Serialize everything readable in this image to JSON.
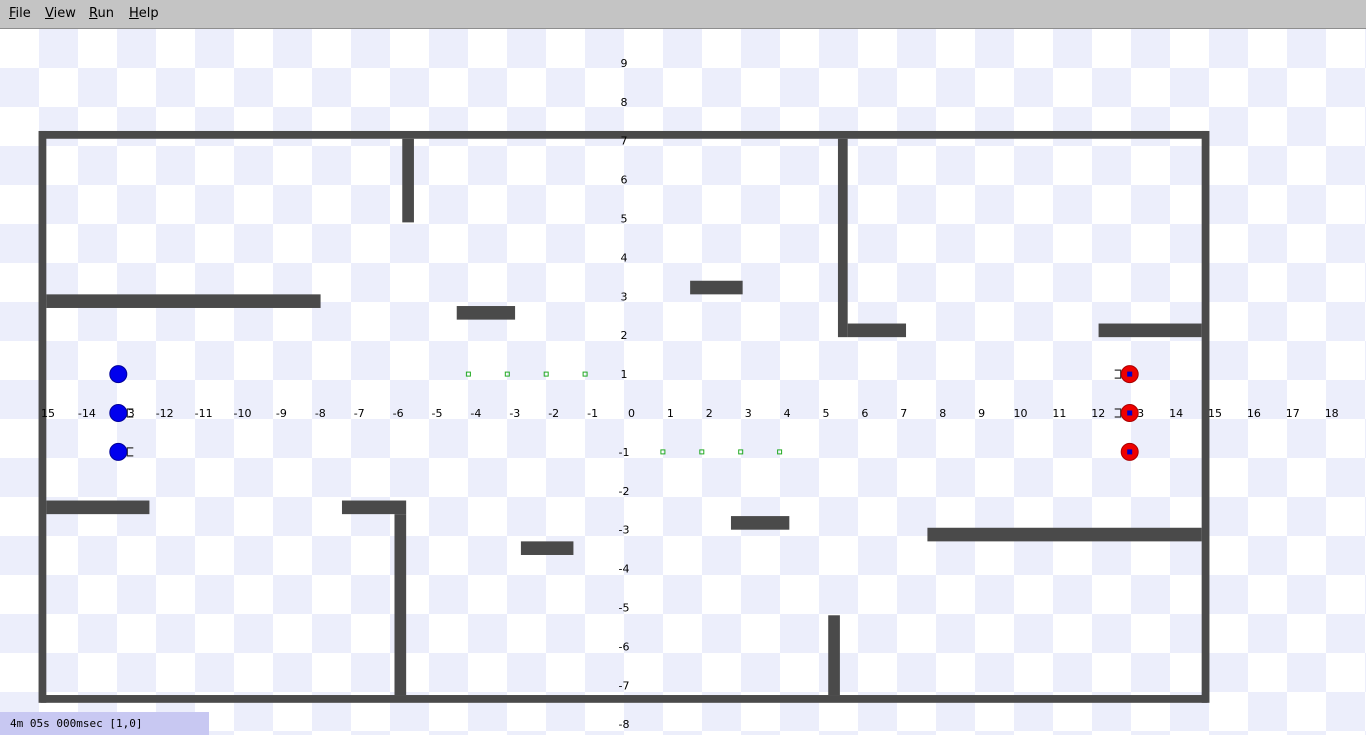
{
  "menu": {
    "file": {
      "mnemonic": "F",
      "rest": "ile"
    },
    "view": {
      "mnemonic": "V",
      "rest": "iew"
    },
    "run": {
      "mnemonic": "R",
      "rest": "un"
    },
    "help": {
      "mnemonic": "H",
      "rest": "elp"
    }
  },
  "status": {
    "text": "4m 05s 000msec [1,0]"
  },
  "colors": {
    "wall": "#4a4a4a",
    "team_blue": "#0000ee",
    "team_red": "#ee0000",
    "red_center": "#0000cc",
    "waypoint": "#22aa22",
    "checker": "#eceefb"
  },
  "field": {
    "x_ticks": [
      "15",
      "-14",
      "-13",
      "-12",
      "-11",
      "-10",
      "-9",
      "-8",
      "-7",
      "-6",
      "-5",
      "-4",
      "-3",
      "-2",
      "-1",
      "0",
      "1",
      "2",
      "3",
      "4",
      "5",
      "6",
      "7",
      "8",
      "9",
      "10",
      "11",
      "12",
      "13",
      "14",
      "15",
      "16",
      "17",
      "18",
      "1"
    ],
    "y_ticks": [
      "9",
      "8",
      "7",
      "6",
      "5",
      "4",
      "3",
      "2",
      "1",
      "-1",
      "-2",
      "-3",
      "-4",
      "-5",
      "-6",
      "-7",
      "-8"
    ],
    "obstacles": [
      {
        "x1": -15,
        "y1": 7.25,
        "x2": 15,
        "y2": 7.05
      },
      {
        "x1": -15,
        "y1": -7.25,
        "x2": 15,
        "y2": -7.45
      },
      {
        "x1": -15.05,
        "y1": 7.25,
        "x2": -14.85,
        "y2": -7.45
      },
      {
        "x1": 14.85,
        "y1": 7.25,
        "x2": 15.05,
        "y2": -7.45
      },
      {
        "x1": -5.7,
        "y1": 7.05,
        "x2": -5.4,
        "y2": 4.9
      },
      {
        "x1": 5.5,
        "y1": 7.05,
        "x2": 5.75,
        "y2": 1.95
      },
      {
        "x1": 5.75,
        "y1": 2.3,
        "x2": 7.25,
        "y2": 1.95
      },
      {
        "x1": 12.2,
        "y1": 2.3,
        "x2": 14.85,
        "y2": 1.95
      },
      {
        "x1": -14.85,
        "y1": 3.05,
        "x2": -7.8,
        "y2": 2.7
      },
      {
        "x1": -4.3,
        "y1": 2.75,
        "x2": -2.8,
        "y2": 2.4
      },
      {
        "x1": 1.7,
        "y1": 3.4,
        "x2": 3.05,
        "y2": 3.05
      },
      {
        "x1": -14.85,
        "y1": -2.25,
        "x2": -12.2,
        "y2": -2.6
      },
      {
        "x1": -7.25,
        "y1": -2.25,
        "x2": -5.6,
        "y2": -2.6
      },
      {
        "x1": -5.9,
        "y1": -2.6,
        "x2": -5.6,
        "y2": -7.25
      },
      {
        "x1": -2.65,
        "y1": -3.3,
        "x2": -1.3,
        "y2": -3.65
      },
      {
        "x1": 2.75,
        "y1": -2.65,
        "x2": 4.25,
        "y2": -3.0
      },
      {
        "x1": 7.8,
        "y1": -2.95,
        "x2": 14.85,
        "y2": -3.3
      },
      {
        "x1": 5.25,
        "y1": -5.2,
        "x2": 5.55,
        "y2": -7.25
      }
    ],
    "waypoints": [
      {
        "x": -4.0,
        "y": 1
      },
      {
        "x": -3.0,
        "y": 1
      },
      {
        "x": -2.0,
        "y": 1
      },
      {
        "x": -1.0,
        "y": 1
      },
      {
        "x": 1.0,
        "y": -1
      },
      {
        "x": 2.0,
        "y": -1
      },
      {
        "x": 3.0,
        "y": -1
      },
      {
        "x": 4.0,
        "y": -1
      }
    ],
    "robots": [
      {
        "team": "blue",
        "x": -13,
        "y": 1,
        "kicker": false
      },
      {
        "team": "blue",
        "x": -13,
        "y": 0,
        "kicker": true
      },
      {
        "team": "blue",
        "x": -13,
        "y": -1,
        "kicker": true
      },
      {
        "team": "red",
        "x": 13,
        "y": 1,
        "kicker": true
      },
      {
        "team": "red",
        "x": 13,
        "y": 0,
        "kicker": true
      },
      {
        "team": "red",
        "x": 13,
        "y": -1,
        "kicker": false
      }
    ]
  }
}
